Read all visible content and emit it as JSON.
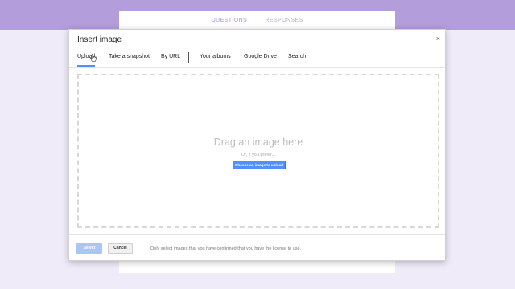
{
  "form": {
    "tabs": [
      {
        "label": "QUESTIONS",
        "active": true
      },
      {
        "label": "RESPONSES",
        "active": false
      }
    ]
  },
  "dialog": {
    "title": "Insert image",
    "close_glyph": "×",
    "tabs": [
      {
        "label": "Upload",
        "active": true
      },
      {
        "label": "Take a snapshot"
      },
      {
        "label": "By URL"
      },
      {
        "label": "Your albums"
      },
      {
        "label": "Google Drive"
      },
      {
        "label": "Search"
      }
    ],
    "dropzone": {
      "heading": "Drag an image here",
      "or_text": "Or, if you prefer...",
      "choose_label": "Choose an image to upload"
    },
    "footer": {
      "select_label": "Select",
      "cancel_label": "Cancel",
      "notice": "Only select images that you have confirmed that you have the license to use."
    }
  },
  "colors": {
    "header_band": "#b39ddb",
    "page_background": "#f0ebf8",
    "accent_blue": "#4d90fe",
    "select_disabled": "#a9c6f7"
  },
  "icons": {
    "close": "close-icon",
    "cursor": "pointer-cursor-icon"
  }
}
